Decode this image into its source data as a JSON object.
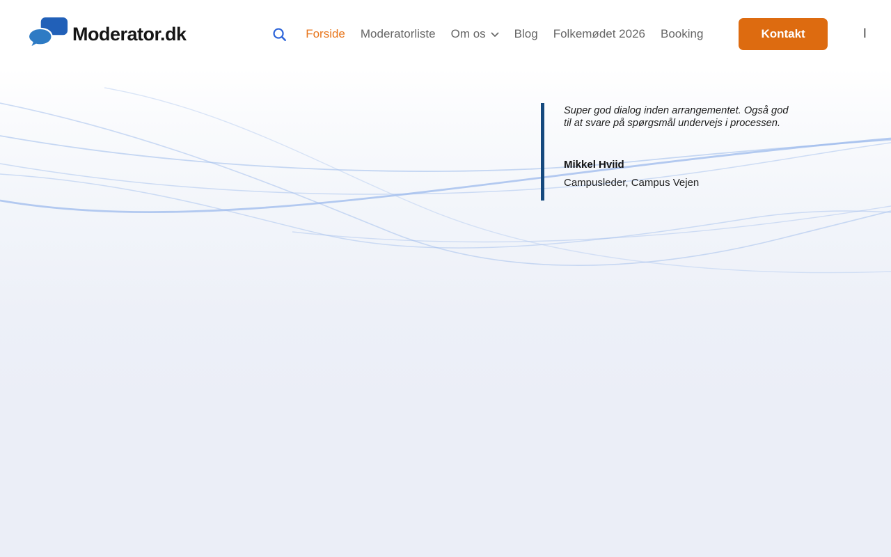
{
  "brand": {
    "name": "Moderator.dk",
    "logo_icon": "speech-bubbles-icon"
  },
  "nav": {
    "search_icon": "search-icon",
    "items": [
      {
        "label": "Forside",
        "active": true
      },
      {
        "label": "Moderatorliste",
        "active": false
      },
      {
        "label": "Om os",
        "active": false,
        "has_dropdown": true
      },
      {
        "label": "Blog",
        "active": false
      },
      {
        "label": "Folkemødet 2026",
        "active": false
      },
      {
        "label": "Booking",
        "active": false
      }
    ],
    "cta_label": "Kontakt",
    "trailing_divider": "I"
  },
  "testimonial": {
    "quote": "Super god dialog inden arrangementet. Også god til at svare på spørgsmål undervejs i processen.",
    "name": "Mikkel Hviid",
    "role": "Campusleder, Campus Vejen"
  },
  "colors": {
    "accent_orange": "#DD6B10",
    "active_link_orange": "#E8761C",
    "nav_gray": "#666666",
    "quote_bar_navy": "#15497E",
    "wave_blue": "#A4BfED",
    "search_icon_blue": "#2B63D9",
    "logo_dark_blue": "#2160B8",
    "logo_light_blue": "#2E7BC4",
    "hero_bottom": "#EBEEF7"
  }
}
